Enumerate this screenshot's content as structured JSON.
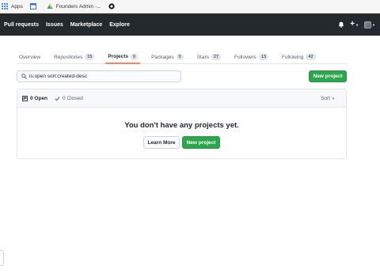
{
  "bookmarks": [
    {
      "label": "Apps",
      "icon": "apps-grid-icon"
    },
    {
      "label": "",
      "icon": "calendar-icon"
    },
    {
      "label": "Founders Admin -...",
      "icon": "drive-icon"
    },
    {
      "label": "",
      "icon": "github-icon"
    }
  ],
  "header": {
    "nav": [
      "Pull requests",
      "Issues",
      "Marketplace",
      "Explore"
    ]
  },
  "tabs": [
    {
      "label": "Overview",
      "count": ""
    },
    {
      "label": "Repositories",
      "count": "15"
    },
    {
      "label": "Projects",
      "count": "0"
    },
    {
      "label": "Packages",
      "count": "0"
    },
    {
      "label": "Stars",
      "count": "27"
    },
    {
      "label": "Followers",
      "count": "13"
    },
    {
      "label": "Following",
      "count": "42"
    }
  ],
  "search": {
    "value": "is:open sort:created-desc"
  },
  "actions": {
    "new_project": "New project"
  },
  "list": {
    "open_label": "0 Open",
    "closed_label": "0 Closed",
    "sort_label": "Sort",
    "empty_title": "You don't have any projects yet.",
    "learn_more": "Learn More",
    "new_project": "New project"
  },
  "colors": {
    "header_bg": "#24292e",
    "primary": "#2ea44f",
    "active_tab": "#f9826c"
  }
}
